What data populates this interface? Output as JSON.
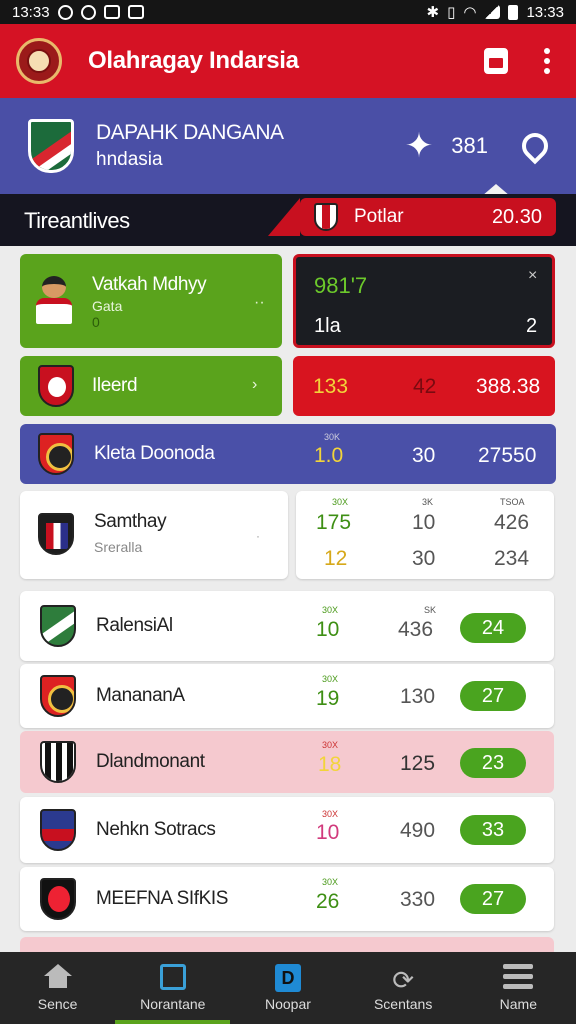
{
  "statusbar": {
    "left_time": "13:33",
    "right_time": "13:33"
  },
  "appbar": {
    "title": "Olahragay Indarsia"
  },
  "team_header": {
    "line1": "DAPAHK DANGANA",
    "line2": "hndasia",
    "count": "381"
  },
  "section": {
    "label": "Tireantlives"
  },
  "match_tab": {
    "name": "Potlar",
    "score": "20.30"
  },
  "featured": {
    "player_name": "Vatkah Mdhyy",
    "player_sub": "Gata",
    "player_sub2": "0",
    "box_top": "981'7",
    "box_bottom_left": "1la",
    "box_bottom_right": "2"
  },
  "rows_top": [
    {
      "name": "Ileerd",
      "tiny": "",
      "v1": "133",
      "v2": "42",
      "v3": "388.38"
    },
    {
      "name": "Kleta Doonoda",
      "tiny": "30K",
      "v1": "1.0",
      "v2": "30",
      "v3": "27550"
    }
  ],
  "split_card": {
    "name": "Samthay",
    "sub": "Sreralla",
    "headers": [
      "30X",
      "3K",
      "TSOA"
    ],
    "row1": [
      "175",
      "10",
      "426"
    ],
    "row2": [
      "12",
      "30",
      "234"
    ]
  },
  "standings": [
    {
      "name": "RalensiAl",
      "tiny1": "30X",
      "tiny2": "SK",
      "v1": "10",
      "v2": "436",
      "pill": "24"
    },
    {
      "name": "ManananA",
      "tiny1": "30X",
      "tiny2": "",
      "v1": "19",
      "v2": "130",
      "pill": "27"
    },
    {
      "name": "Dlandmonant",
      "tiny1": "30X",
      "tiny2": "",
      "v1": "18",
      "v2": "125",
      "pill": "23"
    },
    {
      "name": "Nehkn Sotracs",
      "tiny1": "30X",
      "tiny2": "",
      "v1": "10",
      "v2": "490",
      "pill": "33"
    },
    {
      "name": "MEEFNA SIfKIS",
      "tiny1": "30X",
      "tiny2": "",
      "v1": "26",
      "v2": "330",
      "pill": "27"
    }
  ],
  "bottom_nav": [
    {
      "label": "Sence",
      "icon": "home-icon"
    },
    {
      "label": "Norantane",
      "icon": "document-icon"
    },
    {
      "label": "Noopar",
      "icon": "tab-icon"
    },
    {
      "label": "Scentans",
      "icon": "refresh-icon"
    },
    {
      "label": "Name",
      "icon": "menu-icon"
    }
  ]
}
